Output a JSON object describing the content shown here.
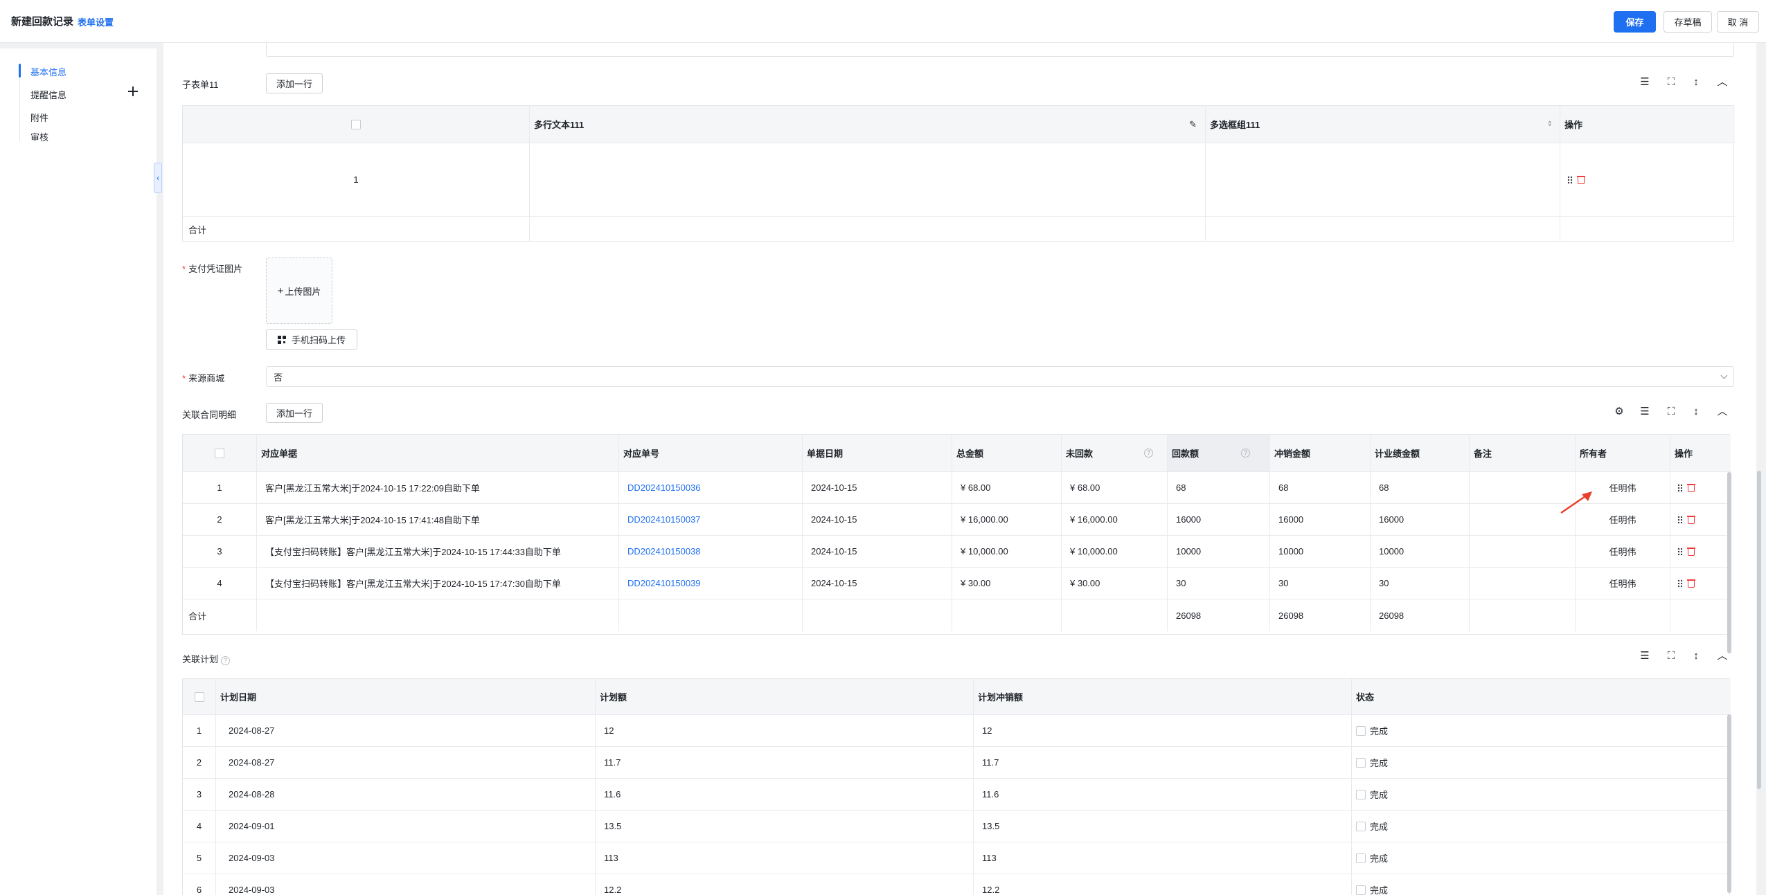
{
  "header": {
    "title": "新建回款记录",
    "form_settings": "表单设置",
    "save": "保存",
    "draft": "存草稿",
    "cancel": "取 消"
  },
  "sidebar": {
    "items": [
      "基本信息",
      "提醒信息",
      "附件",
      "审核"
    ]
  },
  "subform": {
    "label": "子表单11",
    "add_row": "添加一行",
    "columns": [
      "",
      "多行文本111",
      "多选框组111",
      "操作"
    ],
    "rows": [
      {
        "index": "1"
      }
    ],
    "total_label": "合计"
  },
  "payment_image": {
    "label": "支付凭证图片",
    "upload": "上传图片",
    "scan_upload": "手机扫码上传"
  },
  "source_mall": {
    "label": "来源商城",
    "value": "否"
  },
  "contract_detail": {
    "label": "关联合同明细",
    "add_row": "添加一行",
    "columns": [
      "对应单据",
      "对应单号",
      "单据日期",
      "总金额",
      "未回款",
      "回款额",
      "冲销金额",
      "计业绩金额",
      "备注",
      "所有者",
      "操作"
    ],
    "rows": [
      {
        "index": "1",
        "doc": "客户[黑龙江五常大米]于2024-10-15 17:22:09自助下单",
        "no": "DD202410150036",
        "date": "2024-10-15",
        "total": "¥ 68.00",
        "unpaid": "¥ 68.00",
        "paid": "68",
        "offset": "68",
        "perf": "68",
        "remark": "",
        "owner": "任明伟"
      },
      {
        "index": "2",
        "doc": "客户[黑龙江五常大米]于2024-10-15 17:41:48自助下单",
        "no": "DD202410150037",
        "date": "2024-10-15",
        "total": "¥ 16,000.00",
        "unpaid": "¥ 16,000.00",
        "paid": "16000",
        "offset": "16000",
        "perf": "16000",
        "remark": "",
        "owner": "任明伟"
      },
      {
        "index": "3",
        "doc": "【支付宝扫码转账】客户[黑龙江五常大米]于2024-10-15 17:44:33自助下单",
        "no": "DD202410150038",
        "date": "2024-10-15",
        "total": "¥ 10,000.00",
        "unpaid": "¥ 10,000.00",
        "paid": "10000",
        "offset": "10000",
        "perf": "10000",
        "remark": "",
        "owner": "任明伟"
      },
      {
        "index": "4",
        "doc": "【支付宝扫码转账】客户[黑龙江五常大米]于2024-10-15 17:47:30自助下单",
        "no": "DD202410150039",
        "date": "2024-10-15",
        "total": "¥ 30.00",
        "unpaid": "¥ 30.00",
        "paid": "30",
        "offset": "30",
        "perf": "30",
        "remark": "",
        "owner": "任明伟"
      }
    ],
    "total_label": "合计",
    "totals": {
      "paid": "26098",
      "offset": "26098",
      "perf": "26098"
    }
  },
  "plan": {
    "label": "关联计划",
    "columns": [
      "计划日期",
      "计划额",
      "计划冲销额",
      "状态"
    ],
    "rows": [
      {
        "index": "1",
        "date": "2024-08-27",
        "amount": "12",
        "offset": "12",
        "status": "完成"
      },
      {
        "index": "2",
        "date": "2024-08-27",
        "amount": "11.7",
        "offset": "11.7",
        "status": "完成"
      },
      {
        "index": "3",
        "date": "2024-08-28",
        "amount": "11.6",
        "offset": "11.6",
        "status": "完成"
      },
      {
        "index": "4",
        "date": "2024-09-01",
        "amount": "13.5",
        "offset": "13.5",
        "status": "完成"
      },
      {
        "index": "5",
        "date": "2024-09-03",
        "amount": "113",
        "offset": "113",
        "status": "完成"
      },
      {
        "index": "6",
        "date": "2024-09-03",
        "amount": "12.2",
        "offset": "12.2",
        "status": "完成"
      }
    ]
  },
  "colors": {
    "accent": "#1f6ff1",
    "danger": "#f23c3c",
    "annotation": "#e8402c"
  }
}
